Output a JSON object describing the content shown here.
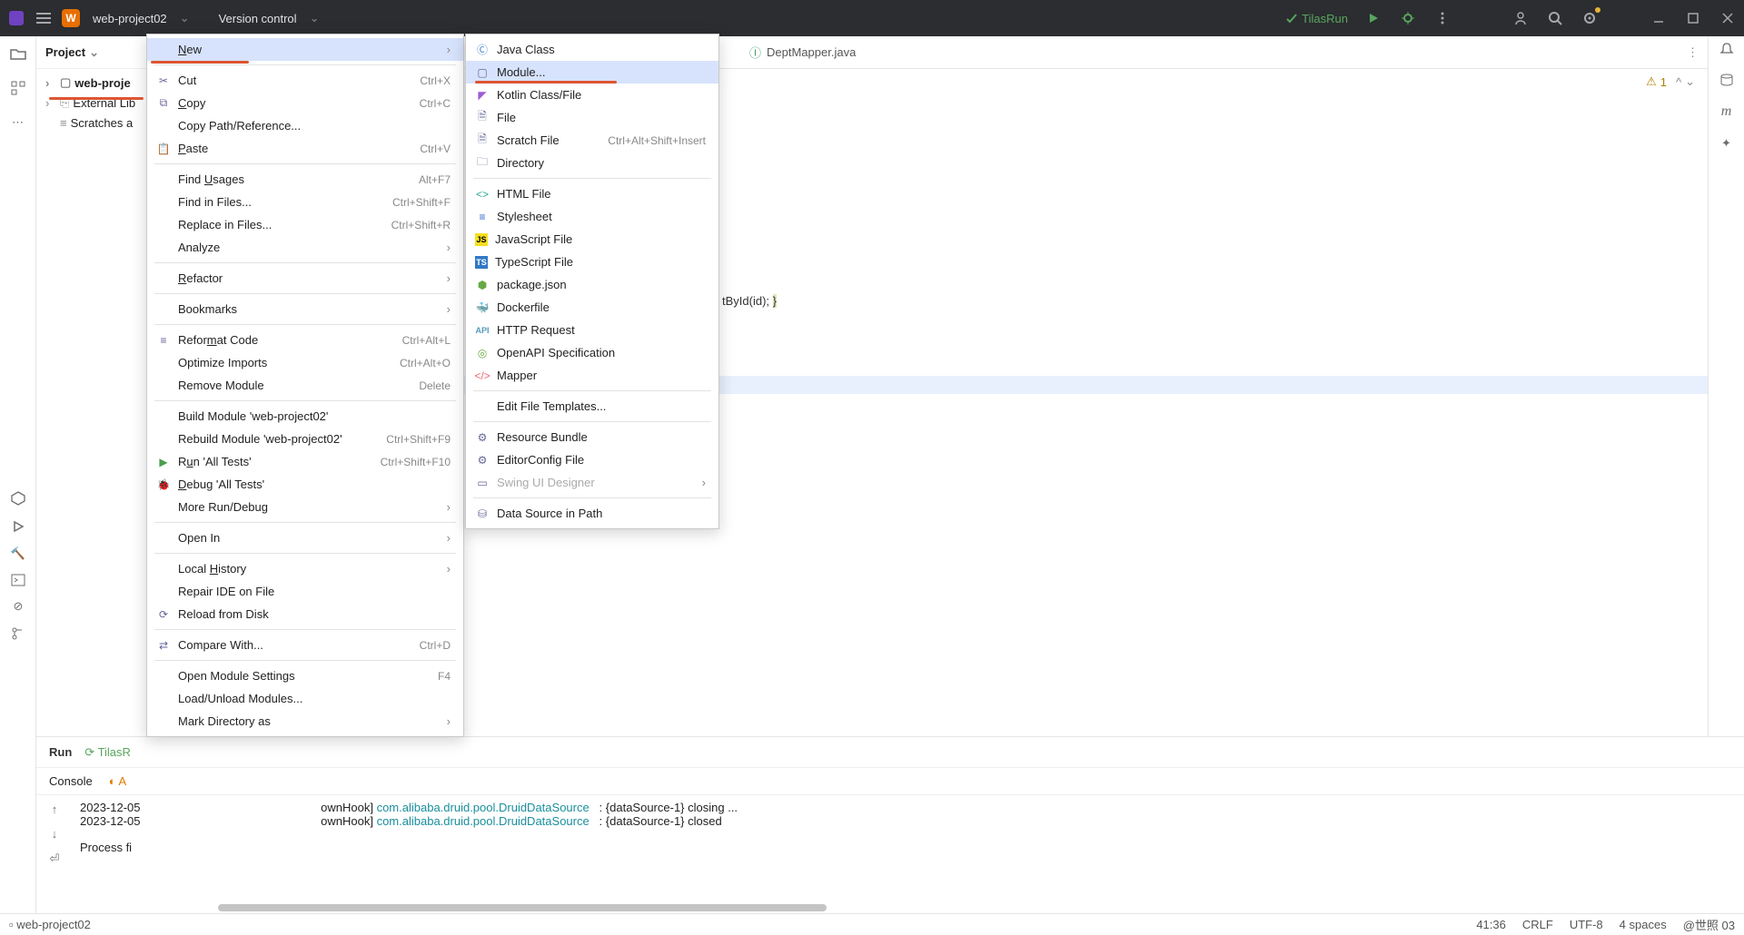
{
  "topbar": {
    "project_initial": "W",
    "project_name": "web-project02",
    "version_control": "Version control",
    "run_config": "TilasRun"
  },
  "project_pane": {
    "title": "Project",
    "tree": {
      "root": "web-proje",
      "ext_lib": "External Lib",
      "scratches": "Scratches a"
    }
  },
  "tabs": {
    "file": "DeptMapper.java"
  },
  "warn_count": "1",
  "code": {
    "fragment": "tById(id); }"
  },
  "context_menu": {
    "new": "New",
    "cut": "Cut",
    "cut_sc": "Ctrl+X",
    "copy": "Copy",
    "copy_sc": "Ctrl+C",
    "copy_path": "Copy Path/Reference...",
    "paste": "Paste",
    "paste_sc": "Ctrl+V",
    "find_usages": "Find Usages",
    "find_usages_sc": "Alt+F7",
    "find_in_files": "Find in Files...",
    "find_in_files_sc": "Ctrl+Shift+F",
    "replace_in_files": "Replace in Files...",
    "replace_in_files_sc": "Ctrl+Shift+R",
    "analyze": "Analyze",
    "refactor": "Refactor",
    "bookmarks": "Bookmarks",
    "reformat": "Reformat Code",
    "reformat_sc": "Ctrl+Alt+L",
    "optimize": "Optimize Imports",
    "optimize_sc": "Ctrl+Alt+O",
    "remove_module": "Remove Module",
    "remove_module_sc": "Delete",
    "build_module": "Build Module 'web-project02'",
    "rebuild_module": "Rebuild Module 'web-project02'",
    "rebuild_sc": "Ctrl+Shift+F9",
    "run_all": "Run 'All Tests'",
    "run_all_sc": "Ctrl+Shift+F10",
    "debug_all": "Debug 'All Tests'",
    "more_run": "More Run/Debug",
    "open_in": "Open In",
    "local_history": "Local History",
    "repair_ide": "Repair IDE on File",
    "reload": "Reload from Disk",
    "compare": "Compare With...",
    "compare_sc": "Ctrl+D",
    "open_settings": "Open Module Settings",
    "open_settings_sc": "F4",
    "load_unload": "Load/Unload Modules...",
    "mark_dir": "Mark Directory as"
  },
  "new_menu": {
    "java_class": "Java Class",
    "module": "Module...",
    "kotlin": "Kotlin Class/File",
    "file": "File",
    "scratch": "Scratch File",
    "scratch_sc": "Ctrl+Alt+Shift+Insert",
    "directory": "Directory",
    "html": "HTML File",
    "stylesheet": "Stylesheet",
    "js": "JavaScript File",
    "ts": "TypeScript File",
    "pkgjson": "package.json",
    "docker": "Dockerfile",
    "http": "HTTP Request",
    "openapi": "OpenAPI Specification",
    "mapper": "Mapper",
    "edit_templates": "Edit File Templates...",
    "resource_bundle": "Resource Bundle",
    "editorconfig": "EditorConfig File",
    "swing": "Swing UI Designer",
    "datasource": "Data Source in Path"
  },
  "run": {
    "tab": "Run",
    "config": "TilasR",
    "console": "Console",
    "actuator": "A",
    "line1_prefix": "2023-12-05",
    "line1_tag": "ownHook] ",
    "line1_pkg": "com.alibaba.druid.pool.DruidDataSource",
    "line1_rest": "   : {dataSource-1} closing ...",
    "line2_prefix": "2023-12-05",
    "line2_tag": "ownHook] ",
    "line2_pkg": "com.alibaba.druid.pool.DruidDataSource",
    "line2_rest": "   : {dataSource-1} closed",
    "proc": "Process fi"
  },
  "status": {
    "project": "web-project02",
    "pos": "41:36",
    "eol": "CRLF",
    "enc": "UTF-8",
    "indent": "4 spaces",
    "trail": "@世照 03"
  }
}
